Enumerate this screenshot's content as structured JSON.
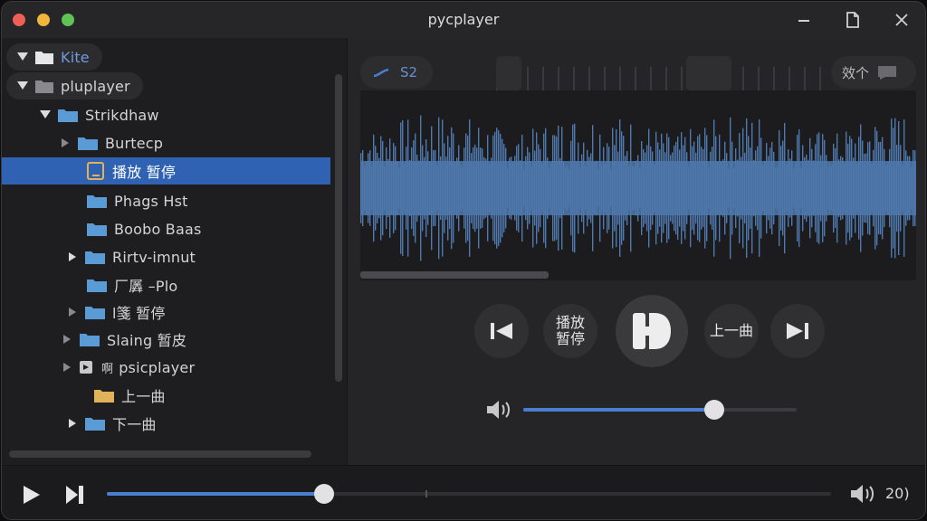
{
  "window": {
    "title": "pycplayer"
  },
  "colors": {
    "accent": "#4a7fd0",
    "selection": "#2f62b3",
    "folder": "#5b9bd5",
    "folder_yellow": "#e0b35a"
  },
  "tree": {
    "items": [
      {
        "label": "Kite",
        "expanded": true,
        "icon": "folder-icon"
      },
      {
        "label": "pluplayer",
        "expanded": true,
        "icon": "folder-icon"
      },
      {
        "label": "Strikdhaw",
        "expanded": true,
        "icon": "folder-icon"
      },
      {
        "label": "Burtecp",
        "expanded": false,
        "icon": "folder-icon"
      },
      {
        "label": "播放 暂停",
        "selected": true,
        "icon": "file-icon"
      },
      {
        "label": "Phags Hst",
        "icon": "folder-icon"
      },
      {
        "label": "Boobo Baas",
        "icon": "folder-icon"
      },
      {
        "label": "Rirtv-imnut",
        "expanded": false,
        "icon": "folder-icon"
      },
      {
        "label": "厂羼 –Plo",
        "icon": "folder-icon"
      },
      {
        "label": "l箋 暂停",
        "expanded": false,
        "icon": "folder-icon"
      },
      {
        "label": "Slaing 暂皮",
        "expanded": false,
        "icon": "folder-icon"
      },
      {
        "label": "psicplayer",
        "prefix": "啊",
        "expanded": false,
        "icon": "player-folder-icon"
      },
      {
        "label": "上一曲",
        "icon": "folder-icon"
      },
      {
        "label": "下一曲",
        "expanded": false,
        "icon": "folder-icon"
      }
    ]
  },
  "waveform": {
    "zoom_label": "S2",
    "right_label": "效个"
  },
  "transport": {
    "prev_icon": "previous-track-icon",
    "play_pause_label_1": "播放",
    "play_pause_label_2": "暂停",
    "main_icon": "play-pause-icon",
    "prev_song_label": "上一曲",
    "next_icon": "next-track-icon"
  },
  "volume": {
    "level": 0.7
  },
  "playback": {
    "progress": 0.3,
    "time": "20)"
  }
}
